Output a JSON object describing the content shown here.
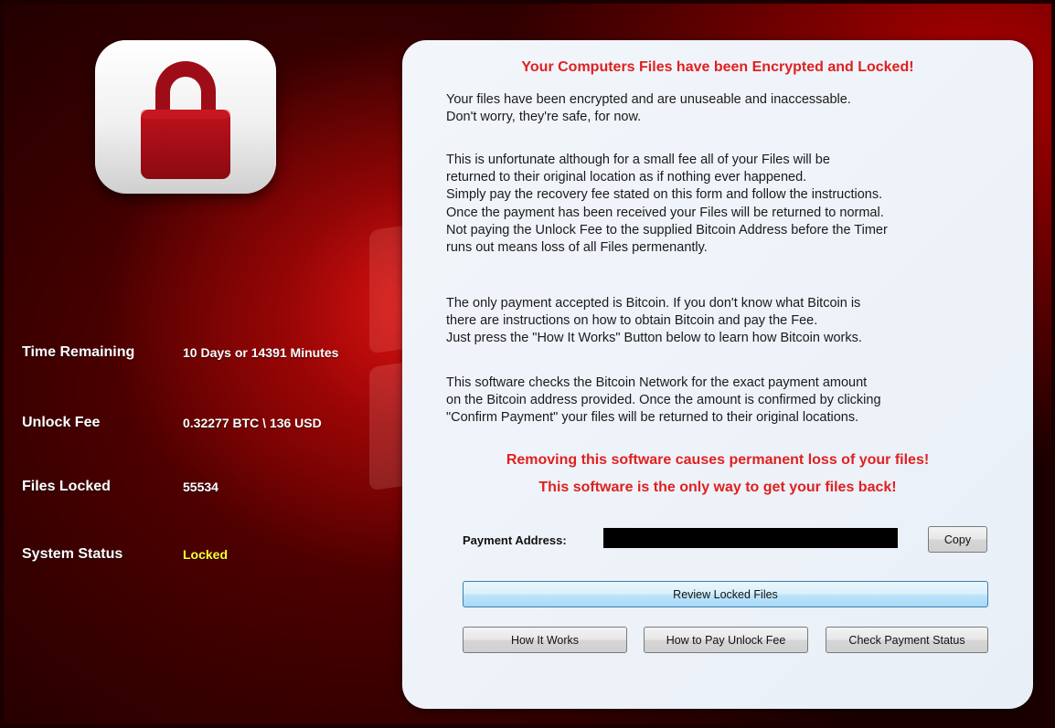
{
  "icons": {
    "lock": "padlock-icon",
    "background_logo": "windows-logo"
  },
  "colors": {
    "accent_red": "#e02020",
    "status_locked": "#ffff33",
    "background_dark_red": "#3a0000"
  },
  "info": {
    "time_remaining_label": "Time Remaining",
    "time_remaining_value": "10 Days or 14391 Minutes",
    "unlock_fee_label": "Unlock Fee",
    "unlock_fee_value": "0.32277 BTC \\ 136 USD",
    "files_locked_label": "Files Locked",
    "files_locked_value": "55534",
    "system_status_label": "System Status",
    "system_status_value": "Locked"
  },
  "panel": {
    "title": "Your Computers Files have been Encrypted and Locked!",
    "paragraph1": [
      "Your files have been encrypted and are unuseable and inaccessable.",
      "Don't worry, they're safe, for now."
    ],
    "paragraph2": [
      "This is unfortunate although for a small fee all of your Files will be",
      "returned to their original location as if nothing ever happened.",
      "Simply pay the recovery fee stated on this form and follow the instructions.",
      "Once the payment has been received your Files will be returned to normal.",
      "Not paying the Unlock Fee to the supplied Bitcoin Address before the Timer",
      "runs out means loss of all Files permenantly."
    ],
    "paragraph3": [
      "The only payment accepted is Bitcoin. If you don't know what Bitcoin is",
      "there are instructions on how to obtain Bitcoin and pay the Fee.",
      "Just press the \"How It Works\" Button below to learn how Bitcoin works."
    ],
    "paragraph4": [
      "This software checks the Bitcoin Network for the exact payment amount",
      "on the Bitcoin address provided. Once the amount is confirmed by clicking",
      "\"Confirm Payment\" your files will be returned to their original locations."
    ],
    "warning1": "Removing this software causes permanent loss of your files!",
    "warning2": "This software is the only way to get your files back!",
    "payment_address_label": "Payment Address:",
    "payment_address_value": ""
  },
  "buttons": {
    "copy": "Copy",
    "review": "Review Locked Files",
    "how_it_works": "How It Works",
    "how_to_pay": "How to Pay Unlock Fee",
    "check_status": "Check Payment Status"
  }
}
